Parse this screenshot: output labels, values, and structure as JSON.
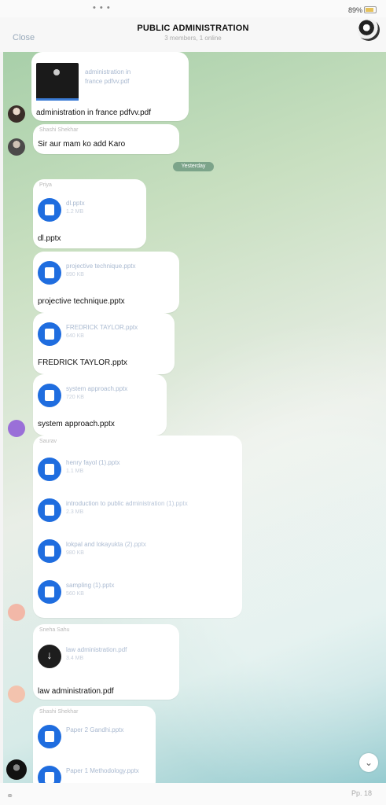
{
  "status": {
    "dots": "• • •",
    "battery": "89%"
  },
  "header": {
    "close_label": "Close",
    "title": "PUBLIC ADMINISTRATION",
    "subtitle": "3 members, 1 online"
  },
  "date_pill": "Yesterday",
  "messages": [
    {
      "thumb_name": "administration in\nfrance pdfvv.pdf",
      "text": "administration in france pdfvv.pdf"
    },
    {
      "sender": "Shashi Shekhar",
      "text": "Sir aur mam ko add Karo"
    },
    {
      "sender": "Priya",
      "file": {
        "name": "dl.pptx",
        "size": "1.2 MB"
      },
      "text": "dl.pptx"
    },
    {
      "file": {
        "name": "projective technique.pptx",
        "size": "890 KB"
      },
      "text": "projective technique.pptx"
    },
    {
      "file": {
        "name": "FREDRICK TAYLOR.pptx",
        "size": "640 KB"
      },
      "text": "FREDRICK TAYLOR.pptx"
    },
    {
      "file": {
        "name": "system approach.pptx",
        "size": "720 KB"
      },
      "text": "system approach.pptx"
    },
    {
      "sender": "Saurav",
      "files": [
        {
          "name": "henry fayol (1).pptx",
          "size": "1.1 MB"
        },
        {
          "name": "introduction to public administration (1).pptx",
          "size": "2.3 MB"
        },
        {
          "name": "lokpal and lokayukta (2).pptx",
          "size": "980 KB"
        },
        {
          "name": "sampling (1).pptx",
          "size": "560 KB"
        }
      ]
    },
    {
      "sender": "Sneha Sahu",
      "file": {
        "name": "law administration.pdf",
        "size": "3.4 MB"
      },
      "text": "law administration.pdf"
    },
    {
      "sender": "Shashi Shekhar",
      "files": [
        {
          "name": "Paper 2 Gandhi.pptx"
        },
        {
          "name": "Paper 1 Methodology.pptx"
        }
      ]
    }
  ],
  "scroll_down_icon": "chevron-down-icon",
  "bottom": {
    "right_text": "Pp. 18"
  }
}
